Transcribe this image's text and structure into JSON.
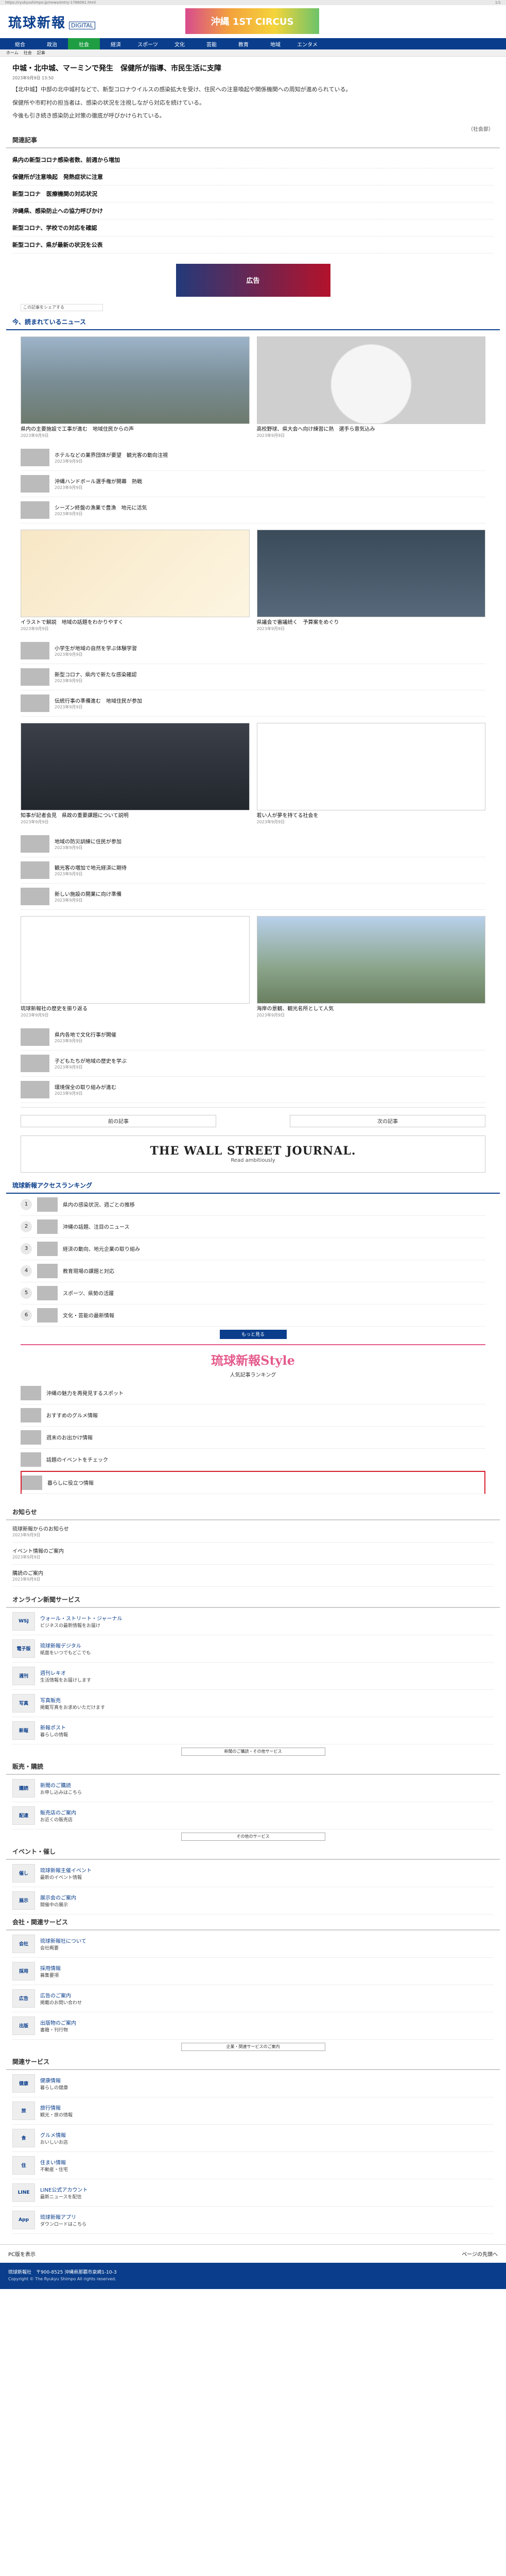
{
  "os_bar": {
    "left": "https://ryukyushimpo.jp/news/entry-1786081.html",
    "right": "1/1"
  },
  "header": {
    "logo": "琉球新報",
    "logo_sub": "DIGITAL",
    "ad_text": "沖縄 1ST CIRCUS"
  },
  "nav": [
    {
      "label": "総合",
      "active": false
    },
    {
      "label": "政治",
      "active": false
    },
    {
      "label": "社会",
      "active": true
    },
    {
      "label": "経済",
      "active": false
    },
    {
      "label": "スポーツ",
      "active": false
    },
    {
      "label": "文化",
      "active": false
    },
    {
      "label": "芸能",
      "active": false
    },
    {
      "label": "教育",
      "active": false
    },
    {
      "label": "地域",
      "active": false
    },
    {
      "label": "エンタメ",
      "active": false
    }
  ],
  "subnav": [
    "ホーム",
    "社会",
    "記事"
  ],
  "article": {
    "title": "中城・北中城、マーミンで発生　保健所が指導、市民生活に支障",
    "meta": "2023年9月9日 13:50",
    "paragraphs": [
      "【北中城】中部の北中城村などで、新型コロナウイルスの感染拡大を受け、住民への注意喚起や関係機関への周知が進められている。",
      "保健所や市町村の担当者は、感染の状況を注視しながら対応を続けている。",
      "今後も引き続き感染防止対策の徹底が呼びかけられている。"
    ],
    "byline": "（社会部）"
  },
  "related_title": "関連記事",
  "related_links": [
    "県内の新型コロナ感染者数、前週から増加",
    "保健所が注意喚起　発熱症状に注意",
    "新型コロナ　医療機関の対応状況",
    "沖縄県、感染防止への協力呼びかけ",
    "新型コロナ、学校での対応を確認",
    "新型コロナ、県が最新の状況を公表"
  ],
  "banner_ad": "広告",
  "share_label": "この記事をシェアする",
  "recommend_title": "今、読まれているニュース",
  "cards_top": [
    {
      "cap": "県内の主要施設で工事が進む　地域住民からの声",
      "date": "2023年9月9日",
      "cls": "t1"
    },
    {
      "cap": "高校野球、県大会へ向け練習に熱　選手ら意気込み",
      "date": "2023年9月9日",
      "cls": "t2"
    }
  ],
  "rows_1": [
    {
      "t": "ホテルなどの業界団体が要望　観光客の動向注視",
      "d": "2023年9月9日"
    },
    {
      "t": "沖縄ハンドボール選手権が開幕　熱戦",
      "d": "2023年9月9日"
    },
    {
      "t": "シーズン終盤の漁業で豊漁　地元に活気",
      "d": "2023年9月9日"
    }
  ],
  "cards_mid": [
    {
      "cap": "イラストで解説　地域の話題をわかりやすく",
      "date": "2023年9月9日",
      "cls": "t3"
    },
    {
      "cap": "県議会で審議続く　予算案をめぐり",
      "date": "2023年9月9日",
      "cls": "t4"
    }
  ],
  "rows_2": [
    {
      "t": "小学生が地域の自然を学ぶ体験学習",
      "d": "2023年9月9日"
    },
    {
      "t": "新型コロナ、県内で新たな感染確認",
      "d": "2023年9月9日"
    },
    {
      "t": "伝統行事の準備進む　地域住民が参加",
      "d": "2023年9月9日"
    }
  ],
  "cards_big": [
    {
      "cap": "知事が記者会見　県政の重要課題について説明",
      "date": "2023年9月9日",
      "cls": "t5"
    },
    {
      "cap": "若い人が夢を持てる社会を",
      "date": "2023年9月9日",
      "cls": "t6"
    }
  ],
  "rows_3": [
    {
      "t": "地域の防災訓練に住民が参加",
      "d": "2023年9月9日"
    },
    {
      "t": "観光客の増加で地元経済に期待",
      "d": "2023年9月9日"
    },
    {
      "t": "新しい施設の開業に向け準備",
      "d": "2023年9月9日"
    }
  ],
  "cards_bottom": [
    {
      "cap": "琉球新報社の歴史を振り返る",
      "date": "2023年9月9日",
      "cls": "t7"
    },
    {
      "cap": "海岸の景観、観光名所として人気",
      "date": "2023年9月9日",
      "cls": "t8"
    }
  ],
  "rows_4": [
    {
      "t": "県内各地で文化行事が開催",
      "d": "2023年9月9日"
    },
    {
      "t": "子どもたちが地域の歴史を学ぶ",
      "d": "2023年9月9日"
    },
    {
      "t": "環境保全の取り組みが進む",
      "d": "2023年9月9日"
    }
  ],
  "pager": {
    "prev": "前の記事",
    "next": "次の記事"
  },
  "wsj": {
    "title": "THE WALL STREET JOURNAL.",
    "sub": "Read ambitiously"
  },
  "ranking_title": "琉球新報アクセスランキング",
  "ranking": [
    {
      "n": "1",
      "t": "県内の感染状況、週ごとの推移"
    },
    {
      "n": "2",
      "t": "沖縄の話題、注目のニュース"
    },
    {
      "n": "3",
      "t": "経済の動向、地元企業の取り組み"
    },
    {
      "n": "4",
      "t": "教育現場の課題と対応"
    },
    {
      "n": "5",
      "t": "スポーツ、県勢の活躍"
    },
    {
      "n": "6",
      "t": "文化・芸能の最新情報"
    }
  ],
  "more_label": "もっと見る",
  "style": {
    "logo_a": "琉球新報",
    "logo_b": "Style",
    "sub": "人気記事ランキング"
  },
  "style_items": [
    {
      "t": "沖縄の魅力を再発見するスポット",
      "hl": false
    },
    {
      "t": "おすすめのグルメ情報",
      "hl": false
    },
    {
      "t": "週末のお出かけ情報",
      "hl": false
    },
    {
      "t": "話題のイベントをチェック",
      "hl": false
    },
    {
      "t": "暮らしに役立つ情報",
      "hl": true
    }
  ],
  "notice_title": "お知らせ",
  "notices": [
    {
      "t": "琉球新報からのお知らせ",
      "d": "2023年9月9日"
    },
    {
      "t": "イベント情報のご案内",
      "d": "2023年9月9日"
    },
    {
      "t": "購読のご案内",
      "d": "2023年9月9日"
    }
  ],
  "online_title": "オンライン新聞サービス",
  "online": [
    {
      "logo": "WSJ",
      "t": "ウォール・ストリート・ジャーナル",
      "s": "ビジネスの最新情報をお届け"
    },
    {
      "logo": "電子版",
      "t": "琉球新報デジタル",
      "s": "紙面をいつでもどこでも"
    },
    {
      "logo": "週刊",
      "t": "週刊レキオ",
      "s": "生活情報をお届けします"
    },
    {
      "logo": "写真",
      "t": "写真販売",
      "s": "掲載写真をお求めいただけます"
    },
    {
      "logo": "新報",
      "t": "新報ポスト",
      "s": "暮らしの情報"
    }
  ],
  "cat1": "新聞のご購読・その他サービス",
  "onsale_title": "販売・購読",
  "onsale": [
    {
      "logo": "購読",
      "t": "新聞のご購読",
      "s": "お申し込みはこちら"
    },
    {
      "logo": "配達",
      "t": "販売店のご案内",
      "s": "お近くの販売店"
    }
  ],
  "cat2": "その他のサービス",
  "event_title": "イベント・催し",
  "events": [
    {
      "logo": "催し",
      "t": "琉球新報主催イベント",
      "s": "最新のイベント情報"
    },
    {
      "logo": "展示",
      "t": "展示会のご案内",
      "s": "開催中の展示"
    }
  ],
  "office_title": "会社・関連サービス",
  "office": [
    {
      "logo": "会社",
      "t": "琉球新報社について",
      "s": "会社概要"
    },
    {
      "logo": "採用",
      "t": "採用情報",
      "s": "募集要項"
    },
    {
      "logo": "広告",
      "t": "広告のご案内",
      "s": "掲載のお問い合わせ"
    },
    {
      "logo": "出版",
      "t": "出版物のご案内",
      "s": "書籍・刊行物"
    }
  ],
  "cat3": "企業・関連サービスのご案内",
  "misc_title": "関連サービス",
  "misc": [
    {
      "logo": "健康",
      "t": "健康情報",
      "s": "暮らしの健康"
    },
    {
      "logo": "旅",
      "t": "旅行情報",
      "s": "観光・旅の情報"
    },
    {
      "logo": "食",
      "t": "グルメ情報",
      "s": "おいしいお店"
    },
    {
      "logo": "住",
      "t": "住まい情報",
      "s": "不動産・住宅"
    },
    {
      "logo": "LINE",
      "t": "LINE公式アカウント",
      "s": "最新ニュースを配信"
    },
    {
      "logo": "App",
      "t": "琉球新報アプリ",
      "s": "ダウンロードはこちら"
    }
  ],
  "footer_links": {
    "left": "PC版を表示",
    "right": "ページの先頭へ"
  },
  "footer": {
    "text": "琉球新報社　〒900-8525 沖縄県那覇市泉崎1-10-3",
    "legal": "Copyright © The Ryukyu Shimpo All rights reserved."
  }
}
